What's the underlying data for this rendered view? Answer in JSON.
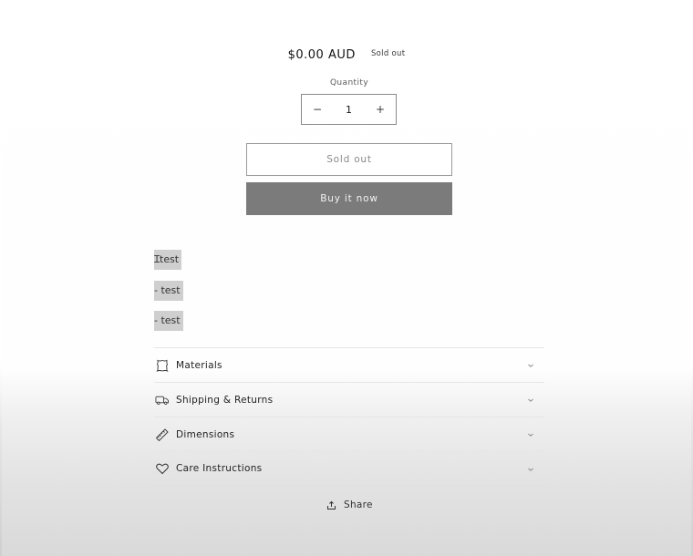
{
  "product": {
    "price": "$0.00 AUD",
    "badge": "Sold out"
  },
  "quantity": {
    "label": "Quantity",
    "value": "1",
    "decrease_label": "−",
    "increase_label": "+"
  },
  "buttons": {
    "sold_out": "Sold out",
    "buy_now": "Buy it now"
  },
  "description_lines": [
    "test",
    "- test",
    "- test"
  ],
  "accordion": [
    {
      "label": "Materials",
      "icon": "leather-icon"
    },
    {
      "label": "Shipping & Returns",
      "icon": "truck-icon"
    },
    {
      "label": "Dimensions",
      "icon": "ruler-icon"
    },
    {
      "label": "Care Instructions",
      "icon": "heart-icon"
    }
  ],
  "share": {
    "label": "Share",
    "icon": "share-icon"
  }
}
